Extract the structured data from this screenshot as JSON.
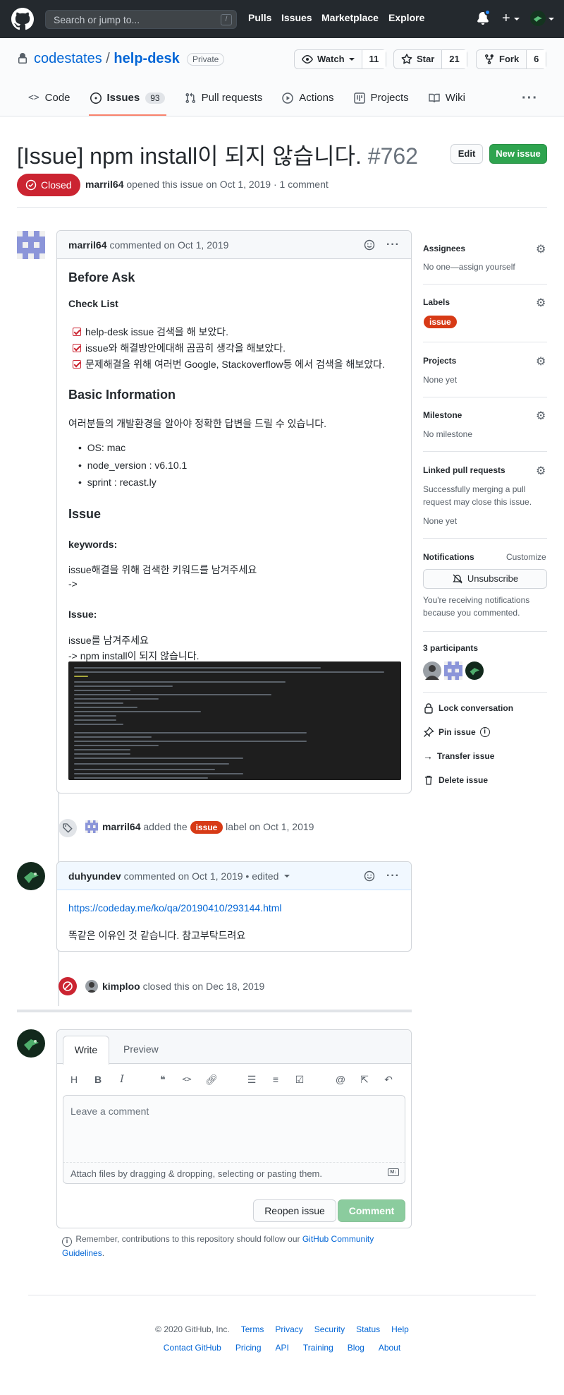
{
  "header": {
    "search_placeholder": "Search or jump to...",
    "slash_key": "/",
    "nav": [
      "Pulls",
      "Issues",
      "Marketplace",
      "Explore"
    ]
  },
  "repo": {
    "owner": "codestates",
    "separator": "/",
    "name": "help-desk",
    "visibility": "Private",
    "watch_label": "Watch",
    "watch_count": "11",
    "star_label": "Star",
    "star_count": "21",
    "fork_label": "Fork",
    "fork_count": "6"
  },
  "tabs": [
    {
      "label": "Code"
    },
    {
      "label": "Issues",
      "count": "93"
    },
    {
      "label": "Pull requests"
    },
    {
      "label": "Actions"
    },
    {
      "label": "Projects"
    },
    {
      "label": "Wiki"
    }
  ],
  "issue": {
    "title": "[Issue] npm install이 되지 않습니다.",
    "number": "#762",
    "state": "Closed",
    "author": "marril64",
    "meta": "opened this issue on Oct 1, 2019 · 1 comment",
    "edit_label": "Edit",
    "new_issue_label": "New issue"
  },
  "first_comment": {
    "author": "marril64",
    "meta": "commented on Oct 1, 2019",
    "h_before": "Before Ask",
    "h_checklist": "Check List",
    "checklist": [
      "help-desk issue 검색을 해 보았다.",
      "issue와 해결방안에대해 곰곰히 생각을 해보았다.",
      "문제해결을 위해 여러번 Google, Stackoverflow등 에서 검색을 해보았다."
    ],
    "h_basic": "Basic Information",
    "basic_text": "여러분들의 개발환경을 알아야 정확한 답변을 드릴 수 있습니다.",
    "env": [
      "OS: mac",
      "node_version : v6.10.1",
      "sprint : recast.ly"
    ],
    "h_issue": "Issue",
    "h_keywords": "keywords:",
    "keywords_text": "issue해결을 위해 검색한 키워드를 남겨주세요",
    "keywords_arrow": "->",
    "h_issue2": "Issue:",
    "issue_text": "issue를 남겨주세요",
    "issue_text2": "-> npm install이 되지 않습니다."
  },
  "label_event": {
    "author": "marril64",
    "pre": "added the",
    "label": "issue",
    "post": "label on Oct 1, 2019"
  },
  "second_comment": {
    "author": "duhyundev",
    "meta": "commented on Oct 1, 2019 • edited",
    "link": "https://codeday.me/ko/qa/20190410/293144.html",
    "text": "똑같은 이유인 것 같습니다. 참고부탁드려요"
  },
  "close_event": {
    "author": "kimploo",
    "text": "closed this on Dec 18, 2019"
  },
  "composer": {
    "write_tab": "Write",
    "preview_tab": "Preview",
    "placeholder": "Leave a comment",
    "attach_hint": "Attach files by dragging & dropping, selecting or pasting them.",
    "reopen_label": "Reopen issue",
    "comment_label": "Comment",
    "remember_text": "Remember, contributions to this repository should follow our",
    "guidelines_link": "GitHub Community Guidelines",
    "guidelines_end": "."
  },
  "sidebar": {
    "assignees_h": "Assignees",
    "assignees_v": "No one—assign yourself",
    "labels_h": "Labels",
    "label": "issue",
    "projects_h": "Projects",
    "projects_v": "None yet",
    "milestone_h": "Milestone",
    "milestone_v": "No milestone",
    "linked_h": "Linked pull requests",
    "linked_text": "Successfully merging a pull request may close this issue.",
    "linked_v": "None yet",
    "notifications_h": "Notifications",
    "customize": "Customize",
    "unsubscribe": "Unsubscribe",
    "notif_text": "You're receiving notifications because you commented.",
    "participants": "3 participants",
    "lock": "Lock conversation",
    "pin": "Pin issue",
    "transfer": "Transfer issue",
    "delete": "Delete issue"
  },
  "footer": {
    "copyright": "© 2020 GitHub, Inc.",
    "row1": [
      "Terms",
      "Privacy",
      "Security",
      "Status",
      "Help"
    ],
    "row2": [
      "Contact GitHub",
      "Pricing",
      "API",
      "Training",
      "Blog",
      "About"
    ]
  },
  "colors": {
    "closed": "#cb2431",
    "label_issue": "#d73a16",
    "green": "#2ea44f",
    "link": "#0366d6",
    "header_bg": "#24292e"
  }
}
